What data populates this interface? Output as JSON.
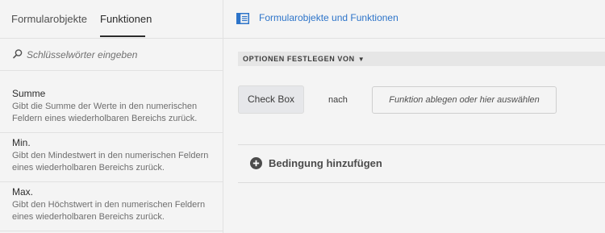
{
  "tabs": [
    "Formularobjekte",
    "Funktionen"
  ],
  "active_tab": "Funktionen",
  "search": {
    "placeholder": "Schlüsselwörter eingeben",
    "value": ""
  },
  "functions": [
    {
      "title": "Summe",
      "desc": "Gibt die Summe der Werte in den numerischen Feldern eines wiederholbaren Bereichs zurück."
    },
    {
      "title": "Min.",
      "desc": "Gibt den Mindestwert in den numerischen Feldern eines wiederholbaren Bereichs zurück."
    },
    {
      "title": "Max.",
      "desc": "Gibt den Höchstwert in den numerischen Feldern eines wiederholbaren Bereichs zurück."
    }
  ],
  "header": {
    "title": "Formularobjekte und Funktionen",
    "icon": "panel-icon"
  },
  "editor": {
    "options_label": "OPTIONEN FESTLEGEN VON",
    "source_chip": "Check Box",
    "connector": "nach",
    "drop_placeholder": "Funktion ablegen oder hier auswählen",
    "add_condition": "Bedingung hinzufügen"
  },
  "colors": {
    "link": "#2d74c9",
    "background": "#f4f4f4"
  }
}
